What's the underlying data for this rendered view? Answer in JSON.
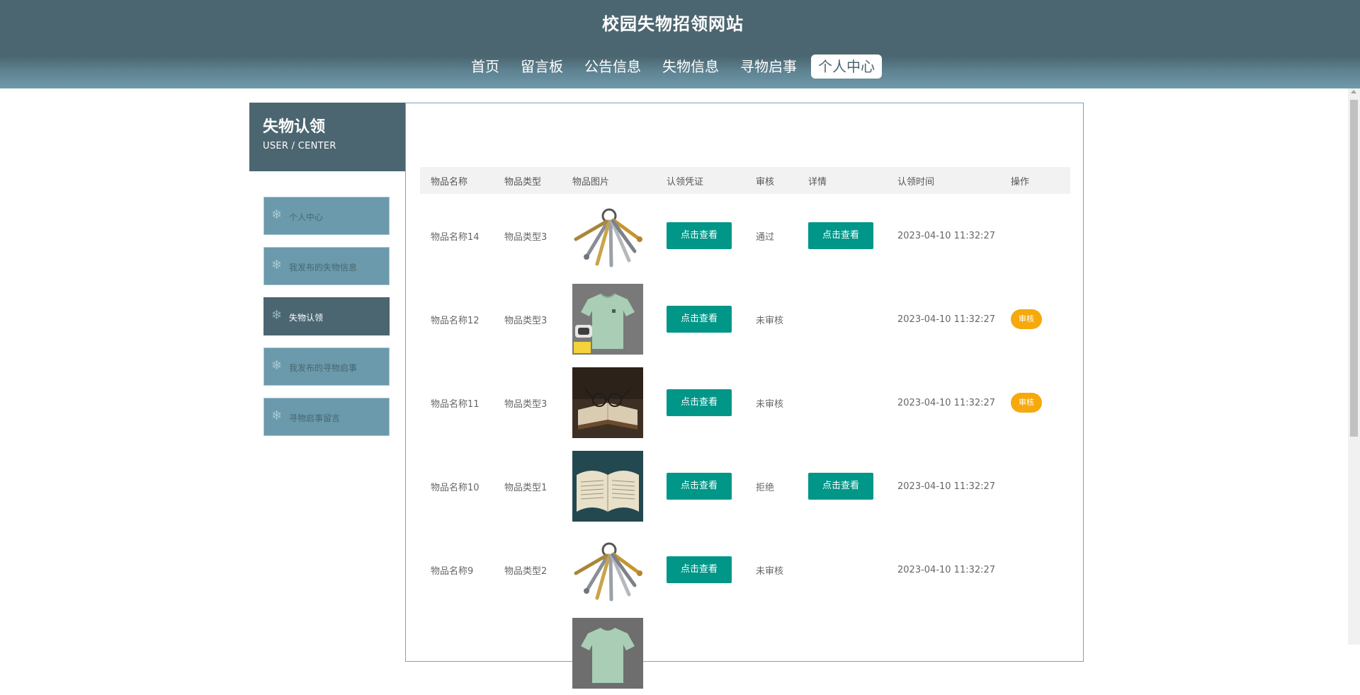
{
  "header": {
    "site_title": "校园失物招领网站",
    "nav": [
      {
        "label": "首页",
        "active": false
      },
      {
        "label": "留言板",
        "active": false
      },
      {
        "label": "公告信息",
        "active": false
      },
      {
        "label": "失物信息",
        "active": false
      },
      {
        "label": "寻物启事",
        "active": false
      },
      {
        "label": "个人中心",
        "active": true
      }
    ]
  },
  "sidebar": {
    "title": "失物认领",
    "subtitle": "USER / CENTER",
    "items": [
      {
        "label": "个人中心",
        "active": false
      },
      {
        "label": "我发布的失物信息",
        "active": false
      },
      {
        "label": "失物认领",
        "active": true
      },
      {
        "label": "我发布的寻物启事",
        "active": false
      },
      {
        "label": "寻物启事留言",
        "active": false
      }
    ]
  },
  "table": {
    "headers": [
      "物品名称",
      "物品类型",
      "物品图片",
      "认领凭证",
      "审核",
      "详情",
      "认领时间",
      "操作"
    ],
    "view_label": "点击查看",
    "audit_label": "审核",
    "rows": [
      {
        "name": "物品名称14",
        "type": "物品类型3",
        "image": "keys",
        "status": "通过",
        "has_detail": true,
        "time": "2023-04-10 11:32:27",
        "has_audit": false
      },
      {
        "name": "物品名称12",
        "type": "物品类型3",
        "image": "tshirt",
        "status": "未审核",
        "has_detail": false,
        "time": "2023-04-10 11:32:27",
        "has_audit": true
      },
      {
        "name": "物品名称11",
        "type": "物品类型3",
        "image": "book-glasses",
        "status": "未审核",
        "has_detail": false,
        "time": "2023-04-10 11:32:27",
        "has_audit": true
      },
      {
        "name": "物品名称10",
        "type": "物品类型1",
        "image": "book-open",
        "status": "拒绝",
        "has_detail": true,
        "time": "2023-04-10 11:32:27",
        "has_audit": false
      },
      {
        "name": "物品名称9",
        "type": "物品类型2",
        "image": "keys",
        "status": "未审核",
        "has_detail": false,
        "time": "2023-04-10 11:32:27",
        "has_audit": false
      },
      {
        "name": "",
        "type": "",
        "image": "tshirt",
        "status": "",
        "has_detail": false,
        "time": "",
        "has_audit": false
      }
    ]
  },
  "colors": {
    "header_bg": "#4b6670",
    "primary_button": "#009688",
    "audit_button": "#f6a90c",
    "sidebar_item": "#6a9aab"
  }
}
